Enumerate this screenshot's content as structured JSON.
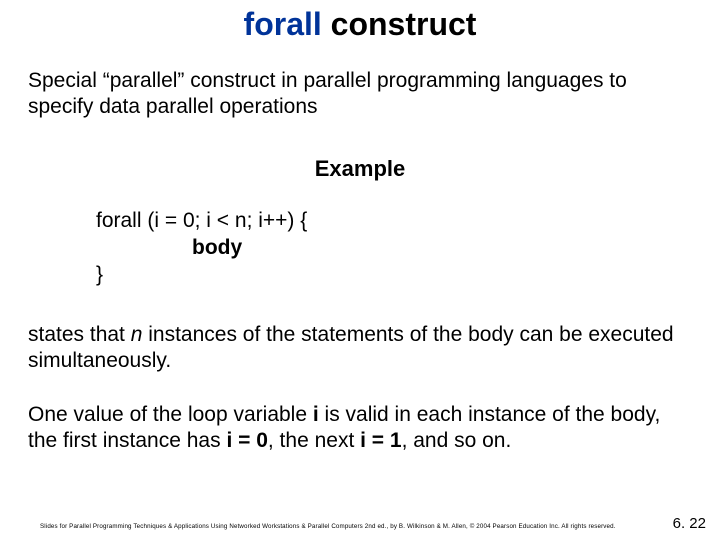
{
  "title": {
    "t1": "forall",
    "t2": " construct"
  },
  "intro": "Special “parallel” construct in parallel programming languages to specify data parallel operations",
  "exampleLabel": "Example",
  "code": {
    "line1": "forall (i = 0; i < n; i++) {",
    "line2": "body",
    "line3": "}"
  },
  "para1": {
    "p1": "states that ",
    "n": "n",
    "p2": " instances of the statements of the body can be executed simultaneously."
  },
  "para2": {
    "p1": "One value of the loop variable ",
    "b1": "i",
    "p2": " is valid in each instance of the body, the first instance has ",
    "b2": "i = 0",
    "p3": ", the next ",
    "b3": "i = 1",
    "p4": ", and so on."
  },
  "footer": "Slides for Parallel Programming Techniques & Applications Using Networked Workstations & Parallel Computers 2nd ed., by B. Wilkinson & M. Allen, © 2004 Pearson Education Inc. All rights reserved.",
  "pagenum": "6. 22"
}
